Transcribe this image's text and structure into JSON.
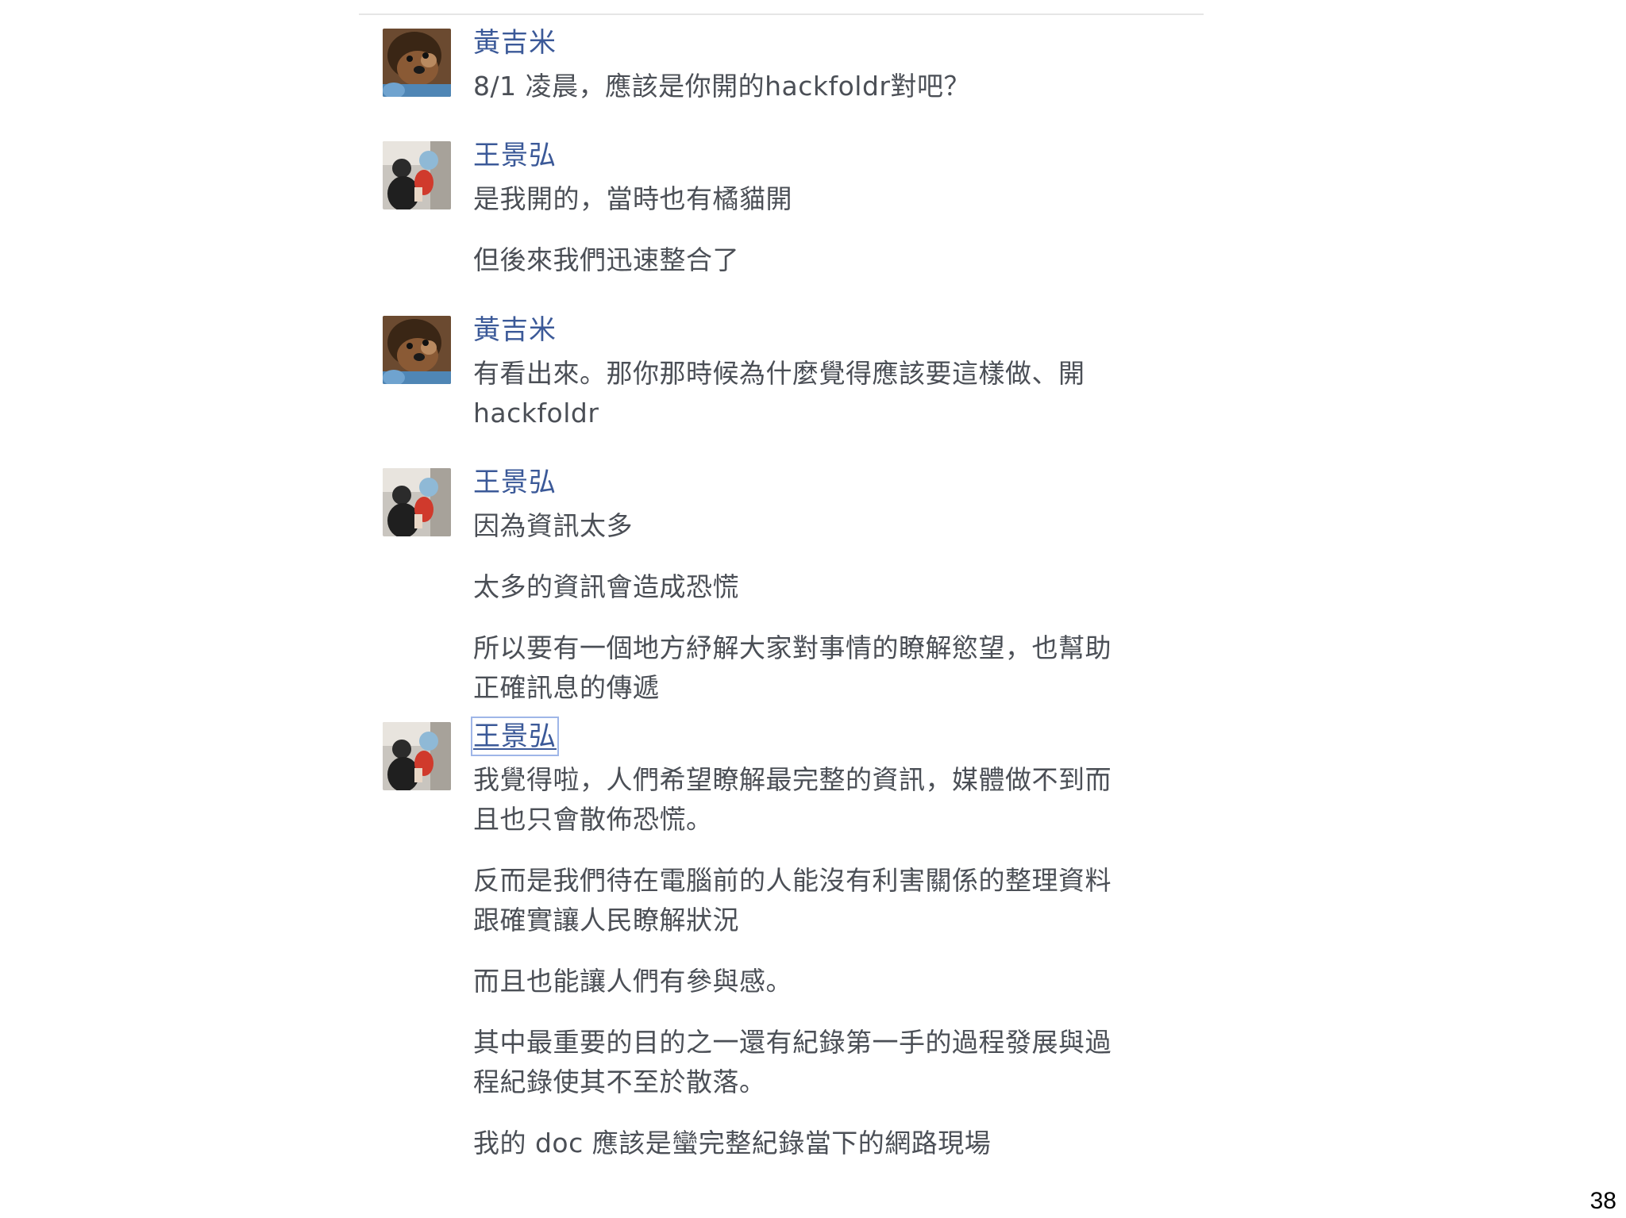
{
  "messages": [
    {
      "sender": "黃吉米",
      "avatar": "profile-photo-dog",
      "lines": [
        "8/1 凌晨，應該是你開的hackfoldr對吧？"
      ]
    },
    {
      "sender": "王景弘",
      "avatar": "profile-photo-person",
      "lines": [
        "是我開的，當時也有橘貓開",
        "但後來我們迅速整合了"
      ]
    },
    {
      "sender": "黃吉米",
      "avatar": "profile-photo-dog",
      "lines": [
        "有看出來。那你那時候為什麼覺得應該要這樣做、開\nhackfoldr"
      ]
    },
    {
      "sender": "王景弘",
      "avatar": "profile-photo-person",
      "lines": [
        "因為資訊太多",
        "太多的資訊會造成恐慌",
        "所以要有一個地方紓解大家對事情的瞭解慾望，也幫助\n正確訊息的傳遞"
      ]
    },
    {
      "sender": "王景弘",
      "avatar": "profile-photo-person",
      "lines": [
        "我覺得啦，人們希望瞭解最完整的資訊，媒體做不到而\n且也只會散佈恐慌。",
        "反而是我們待在電腦前的人能沒有利害關係的整理資料\n跟確實讓人民瞭解狀況",
        "而且也能讓人們有參與感。",
        "其中最重要的目的之一還有紀錄第一手的過程發展與過\n程紀錄使其不至於散落。",
        "我的 doc 應該是蠻完整紀錄當下的網路現場"
      ]
    }
  ],
  "page_number": "38",
  "colors": {
    "sender_name": "#3b5998",
    "message_text": "#4b4f56",
    "divider": "#e6e6e6"
  }
}
